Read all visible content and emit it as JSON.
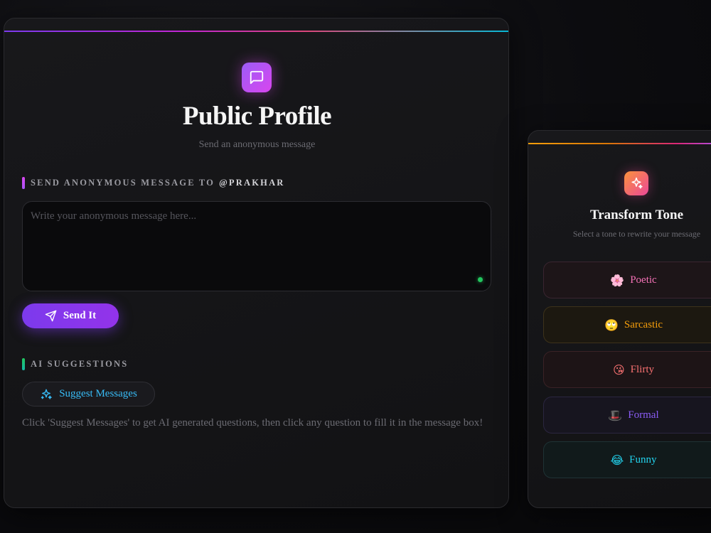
{
  "header": {
    "title": "Public Profile",
    "subtitle": "Send an anonymous message",
    "icon": "chat-bubble-icon"
  },
  "send_section": {
    "label": "SEND ANONYMOUS MESSAGE TO",
    "username": "@PRAKHAR",
    "message_placeholder": "Write your anonymous message here...",
    "message_value": "",
    "send_label": "Send It",
    "send_icon": "paper-plane-icon"
  },
  "ai_section": {
    "label": "AI SUGGESTIONS",
    "suggest_label": "Suggest Messages",
    "suggest_icon": "sparkles-icon",
    "help_text": "Click 'Suggest Messages' to get AI generated questions, then click any question to fill it in the message box!"
  },
  "tone_panel": {
    "title": "Transform Tone",
    "subtitle": "Select a tone to rewrite your message",
    "icon": "sparkles-icon",
    "tones": [
      {
        "label": "Poetic",
        "emoji": "🌸",
        "color": "#f472b6"
      },
      {
        "label": "Sarcastic",
        "emoji": "🙄",
        "color": "#f59e0b"
      },
      {
        "label": "Flirty",
        "emoji": "😘",
        "color": "#f87171"
      },
      {
        "label": "Formal",
        "emoji": "🎩",
        "color": "#8b5cf6"
      },
      {
        "label": "Funny",
        "emoji": "😂",
        "color": "#22d3ee"
      }
    ]
  },
  "colors": {
    "accent_purple": "#7c3aed",
    "accent_pink": "#d946ef",
    "status_green": "#22c55e",
    "link_cyan": "#38bdf8"
  }
}
